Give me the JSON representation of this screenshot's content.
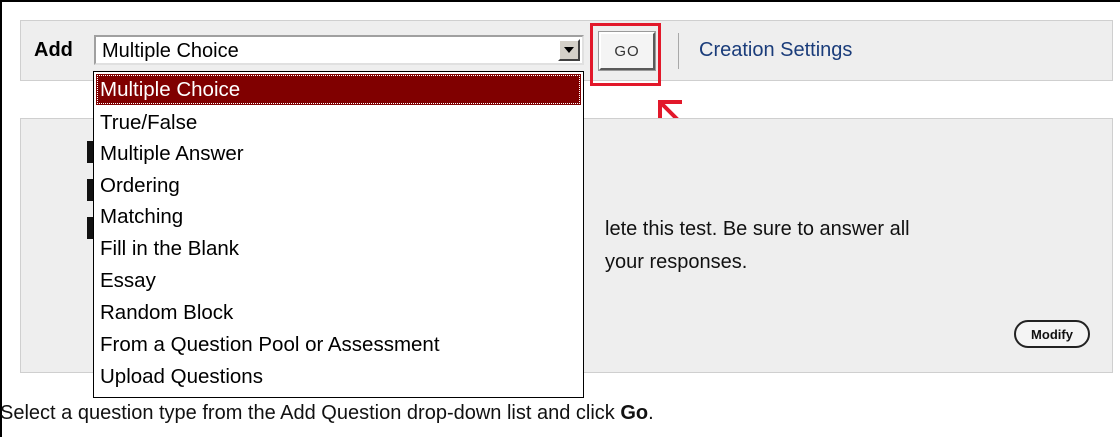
{
  "toolbar": {
    "add_label": "Add",
    "select_value": "Multiple Choice",
    "go_label": "GO",
    "creation_settings_label": "Creation Settings",
    "highlight_color": "#e2182a"
  },
  "dropdown": {
    "items": [
      "Multiple Choice",
      "True/False",
      "Multiple Answer",
      "Ordering",
      "Matching",
      "Fill in the Blank",
      "Essay",
      "Random Block",
      "From a Question Pool or Assessment",
      "Upload Questions"
    ],
    "selected_color": "#800000"
  },
  "panel": {
    "text_line_1": "lete this test. Be sure to answer all",
    "text_line_2": "your responses.",
    "modify_label": "Modify"
  },
  "instruction": {
    "text": "Select a question type from the Add Question drop-down list and click ",
    "bold": "Go",
    "end": "."
  }
}
